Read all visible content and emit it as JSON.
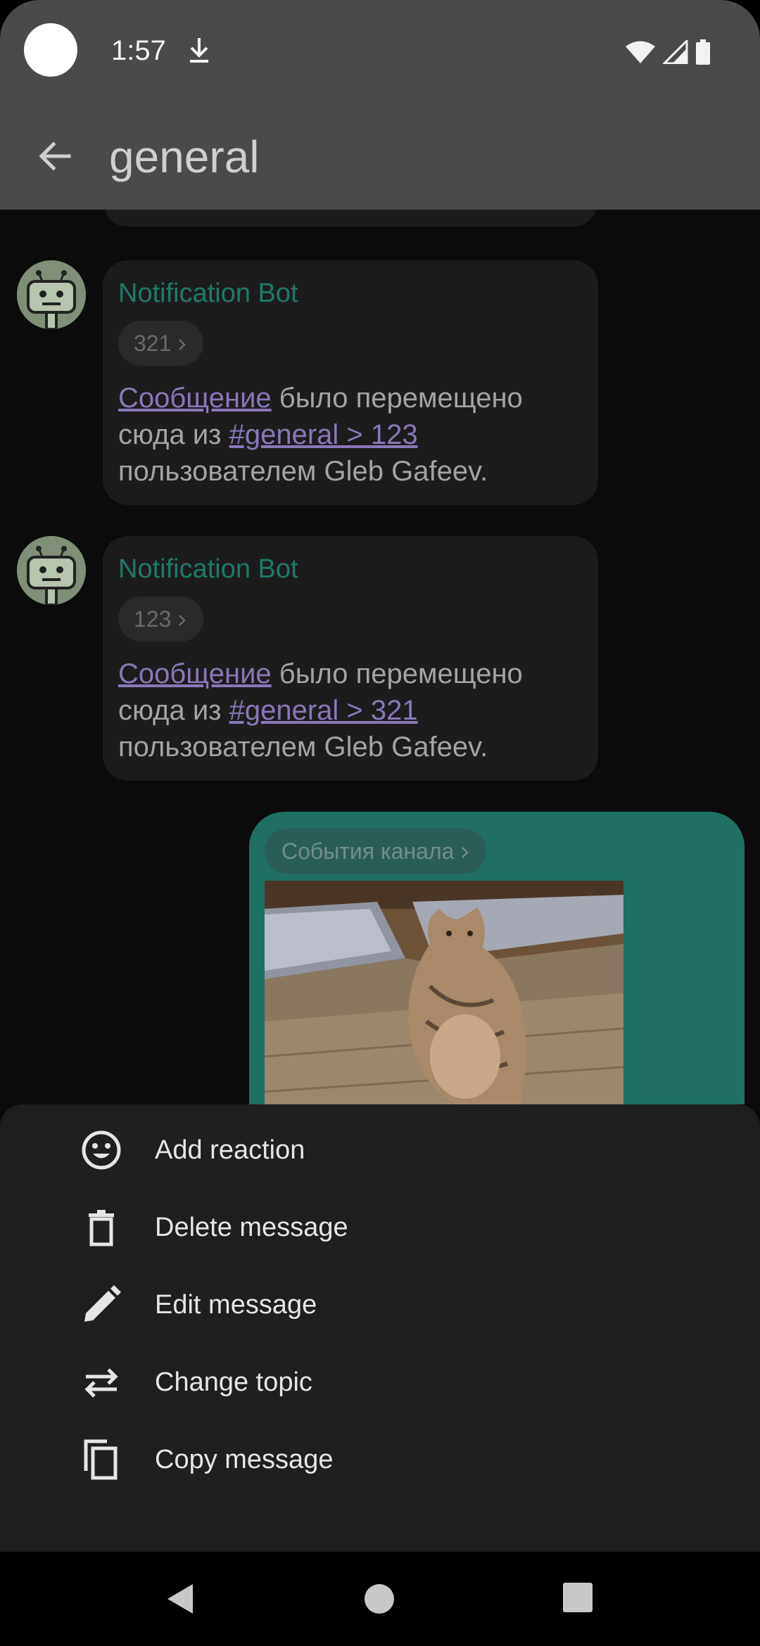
{
  "status_bar": {
    "time": "1:57",
    "icons": [
      "download-icon",
      "wifi-icon",
      "signal-icon",
      "battery-icon"
    ]
  },
  "app_bar": {
    "title": "general",
    "back_icon": "arrow-back-icon"
  },
  "messages": [
    {
      "sender": "Notification Bot",
      "topic": "321",
      "link1": "Сообщение",
      "text1": " было перемещено сюда из ",
      "link2": "#general > 123",
      "text2": " пользователем Gleb Gafeev."
    },
    {
      "sender": "Notification Bot",
      "topic": "123",
      "link1": "Сообщение",
      "text1": " было перемещено сюда из ",
      "link2": "#general > 321",
      "text2": " пользователем Gleb Gafeev."
    }
  ],
  "own_message": {
    "topic": "События канала",
    "image": "photo of a tabby cat sitting against a cabinet"
  },
  "sheet": {
    "items": [
      {
        "label": "Add reaction",
        "icon": "emoji-icon"
      },
      {
        "label": "Delete message",
        "icon": "trash-icon"
      },
      {
        "label": "Edit message",
        "icon": "pencil-icon"
      },
      {
        "label": "Change topic",
        "icon": "swap-arrows-icon"
      },
      {
        "label": "Copy message",
        "icon": "copy-icon"
      }
    ]
  },
  "colors": {
    "accent": "#1f7a6a",
    "link": "#8a78b8",
    "sheet_bg": "#1f1f1f",
    "app_bar_bg": "#4a4a4a"
  }
}
